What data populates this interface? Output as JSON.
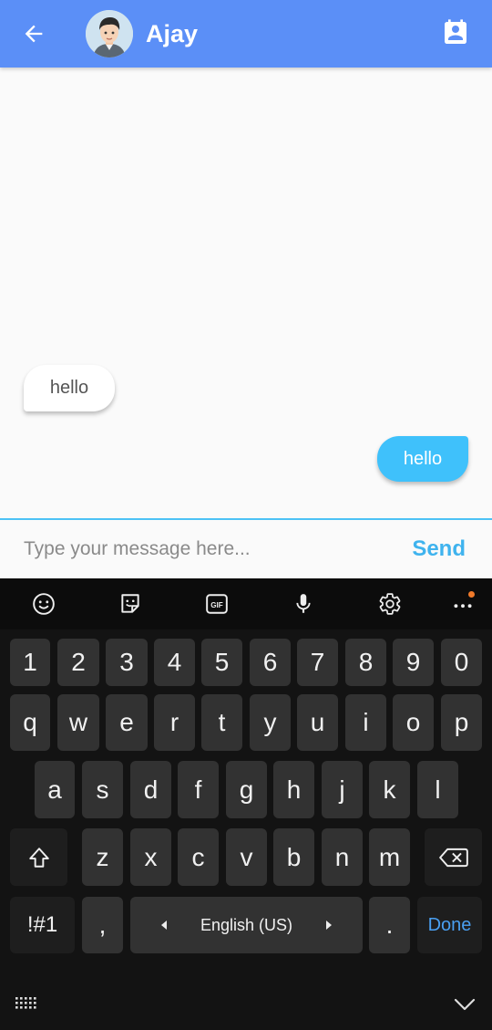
{
  "app_bar": {
    "title": "Ajay",
    "back_icon": "arrow-left-icon",
    "contact_icon": "contact-card-icon",
    "background": "#5b8ff7"
  },
  "messages": [
    {
      "direction": "incoming",
      "text": "hello"
    },
    {
      "direction": "outgoing",
      "text": "hello"
    }
  ],
  "compose": {
    "placeholder": "Type your message here...",
    "send_label": "Send",
    "accent": "#3fb3ee"
  },
  "keyboard": {
    "toolbar": [
      "emoji-icon",
      "sticker-icon",
      "gif-icon",
      "microphone-icon",
      "settings-icon",
      "more-icon"
    ],
    "gif_label": "GIF",
    "row_numbers": [
      "1",
      "2",
      "3",
      "4",
      "5",
      "6",
      "7",
      "8",
      "9",
      "0"
    ],
    "row_1": [
      "q",
      "w",
      "e",
      "r",
      "t",
      "y",
      "u",
      "i",
      "o",
      "p"
    ],
    "row_2": [
      "a",
      "s",
      "d",
      "f",
      "g",
      "h",
      "j",
      "k",
      "l"
    ],
    "row_3": [
      "z",
      "x",
      "c",
      "v",
      "b",
      "n",
      "m"
    ],
    "symbols_label": "!#1",
    "comma_label": ",",
    "space_label": "English (US)",
    "period_label": ".",
    "done_label": "Done"
  }
}
